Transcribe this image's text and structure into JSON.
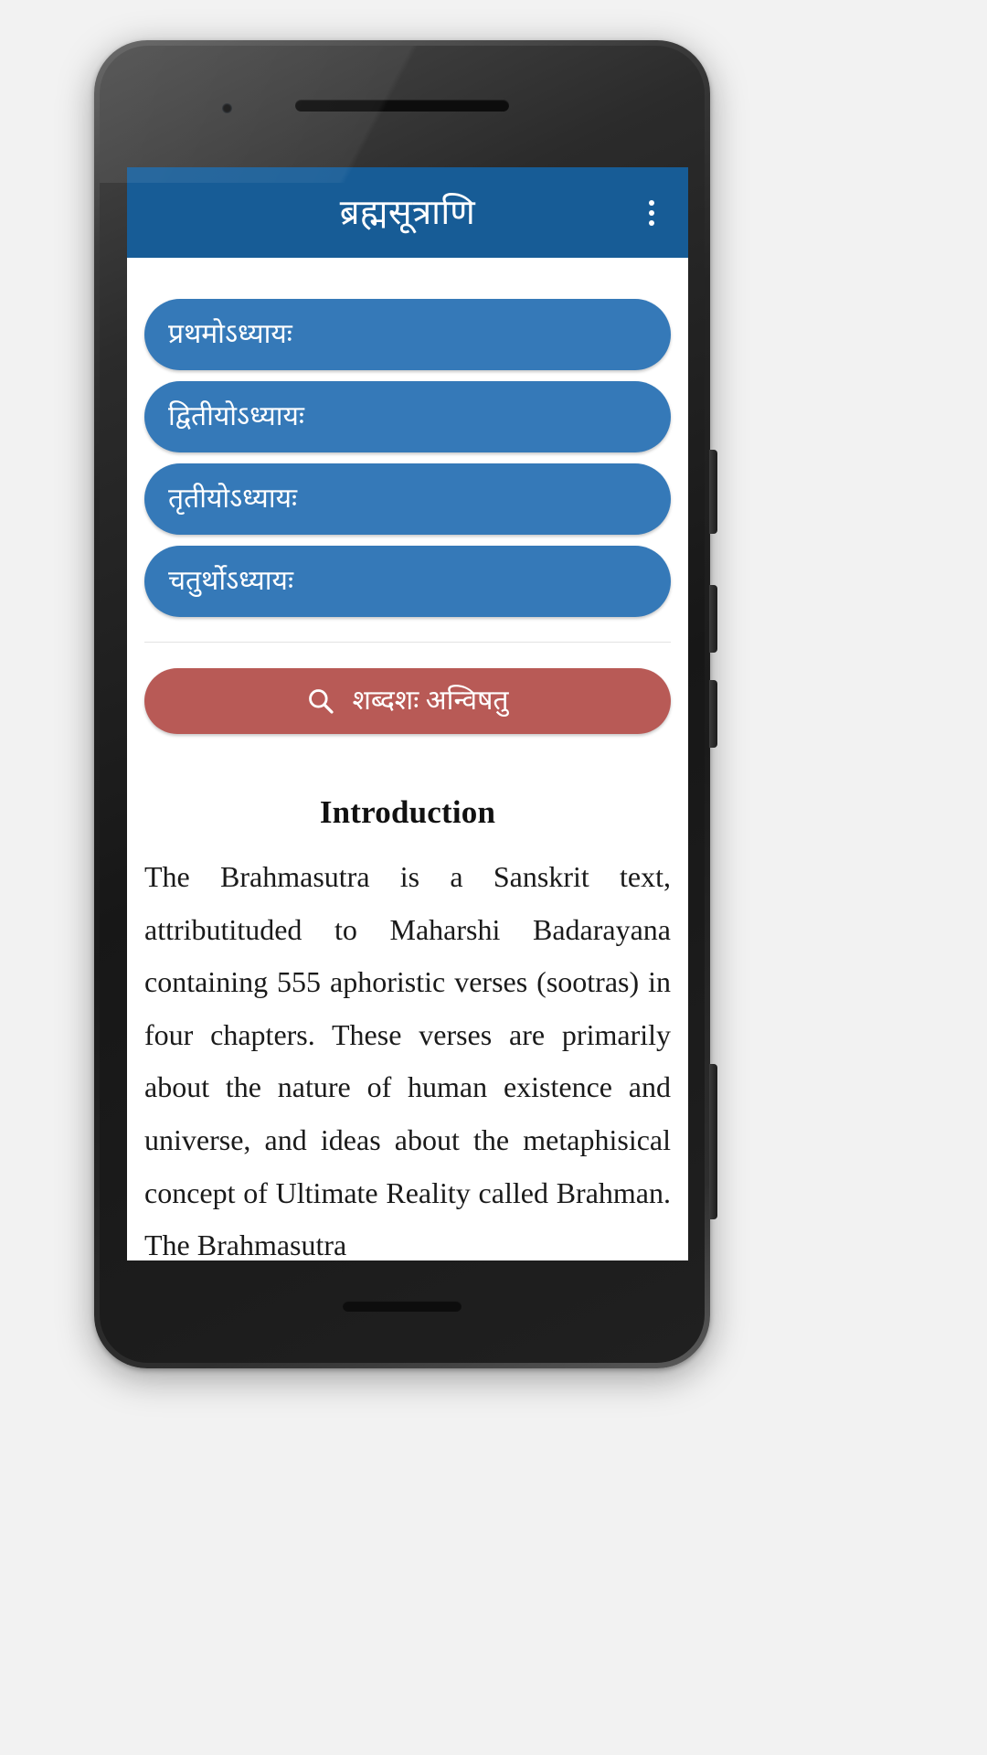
{
  "appbar": {
    "title": "ब्रह्मसूत्राणि",
    "overflow_label": "more-options"
  },
  "chapters": [
    {
      "label": "प्रथमोऽध्यायः"
    },
    {
      "label": "द्वितीयोऽध्यायः"
    },
    {
      "label": "तृतीयोऽध्यायः"
    },
    {
      "label": "चतुर्थोऽध्यायः"
    }
  ],
  "search": {
    "label": "शब्दशः अन्विषतु",
    "icon": "search-icon"
  },
  "intro": {
    "heading": "Introduction",
    "body": "The Brahmasutra is a Sanskrit text, attributituded to Maharshi Badarayana containing 555 aphoristic verses (sootras) in four chapters. These verses are primarily about the nature of human existence and universe, and ideas about the metaphisical concept of Ultimate Reality called Brahman. The Brahmasutra"
  },
  "colors": {
    "appbar": "#175C96",
    "chapter_button": "#3579B8",
    "search_button": "#B85A56",
    "screen_background": "#FFFFFF",
    "page_background": "#F2F2F2"
  }
}
